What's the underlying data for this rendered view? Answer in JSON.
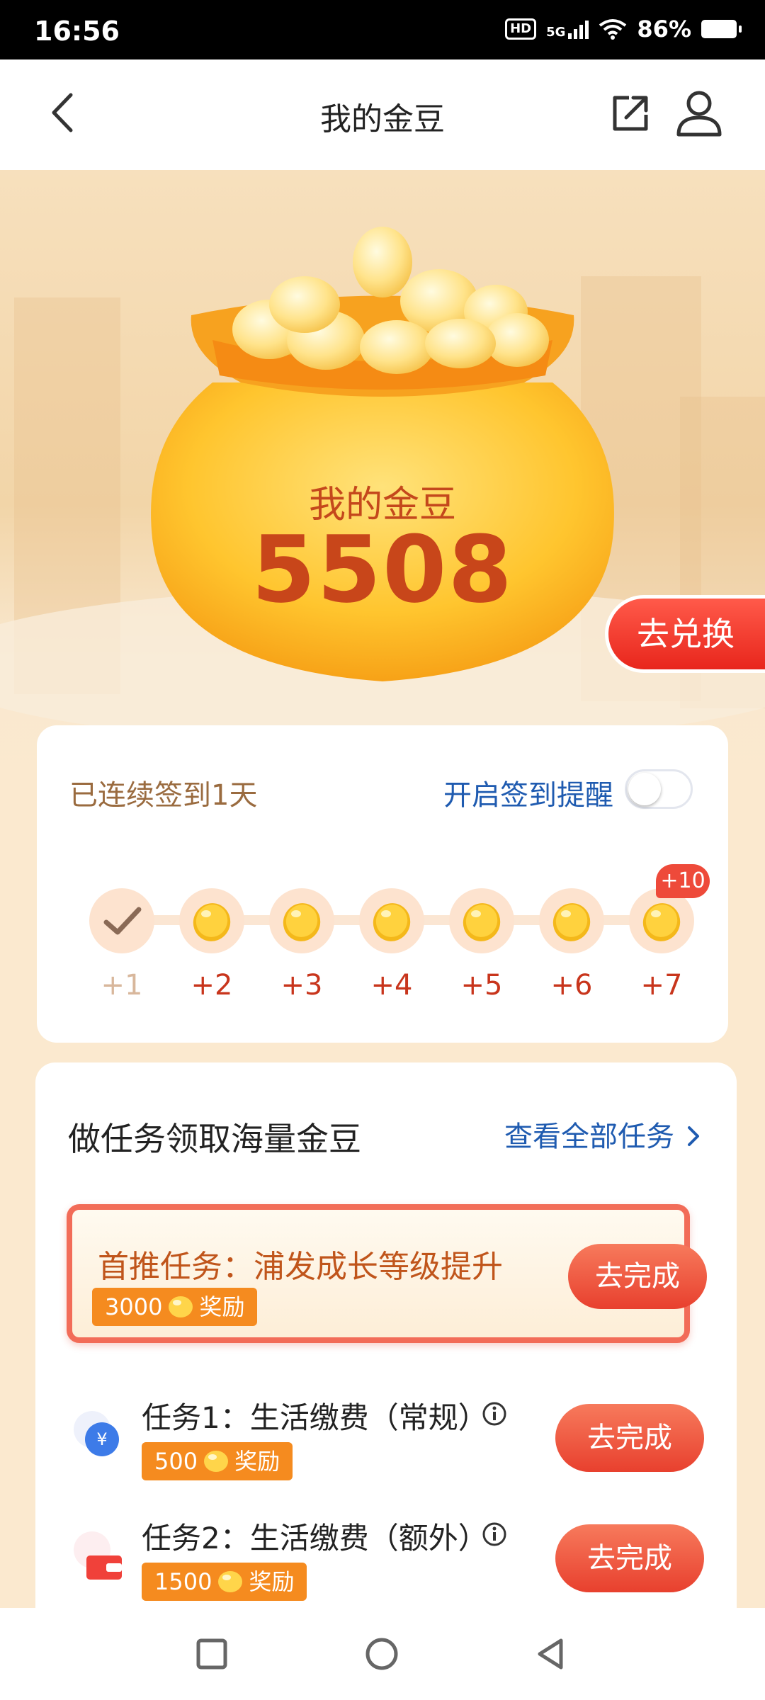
{
  "status_bar": {
    "time": "16:56",
    "hd": "HD",
    "network": "5G",
    "battery": "86%"
  },
  "header": {
    "title": "我的金豆"
  },
  "hero": {
    "pot_title": "我的金豆",
    "bean_count": "5508",
    "exchange_label": "去兑换"
  },
  "signin": {
    "streak_text": "已连续签到1天",
    "reminder_label": "开启签到提醒",
    "reminder_on": false,
    "bonus_badge": "+10",
    "days": [
      {
        "label": "+1",
        "done": true
      },
      {
        "label": "+2",
        "done": false
      },
      {
        "label": "+3",
        "done": false
      },
      {
        "label": "+4",
        "done": false
      },
      {
        "label": "+5",
        "done": false
      },
      {
        "label": "+6",
        "done": false
      },
      {
        "label": "+7",
        "done": false
      }
    ]
  },
  "tasks": {
    "title": "做任务领取海量金豆",
    "view_all": "查看全部任务",
    "featured": {
      "name": "首推任务：浦发成长等级提升",
      "reward_amount": "3000",
      "reward_label": "奖励",
      "action": "去完成"
    },
    "items": [
      {
        "name": "任务1：生活缴费（常规）",
        "reward_amount": "500",
        "reward_label": "奖励",
        "action": "去完成"
      },
      {
        "name": "任务2：生活缴费（额外）",
        "reward_amount": "1500",
        "reward_label": "奖励",
        "action": "去完成"
      }
    ]
  },
  "colors": {
    "accent_red": "#e8402e",
    "link_blue": "#1f5bb0",
    "reward_orange": "#f58b1f",
    "bean_gold": "#f5c21c"
  }
}
